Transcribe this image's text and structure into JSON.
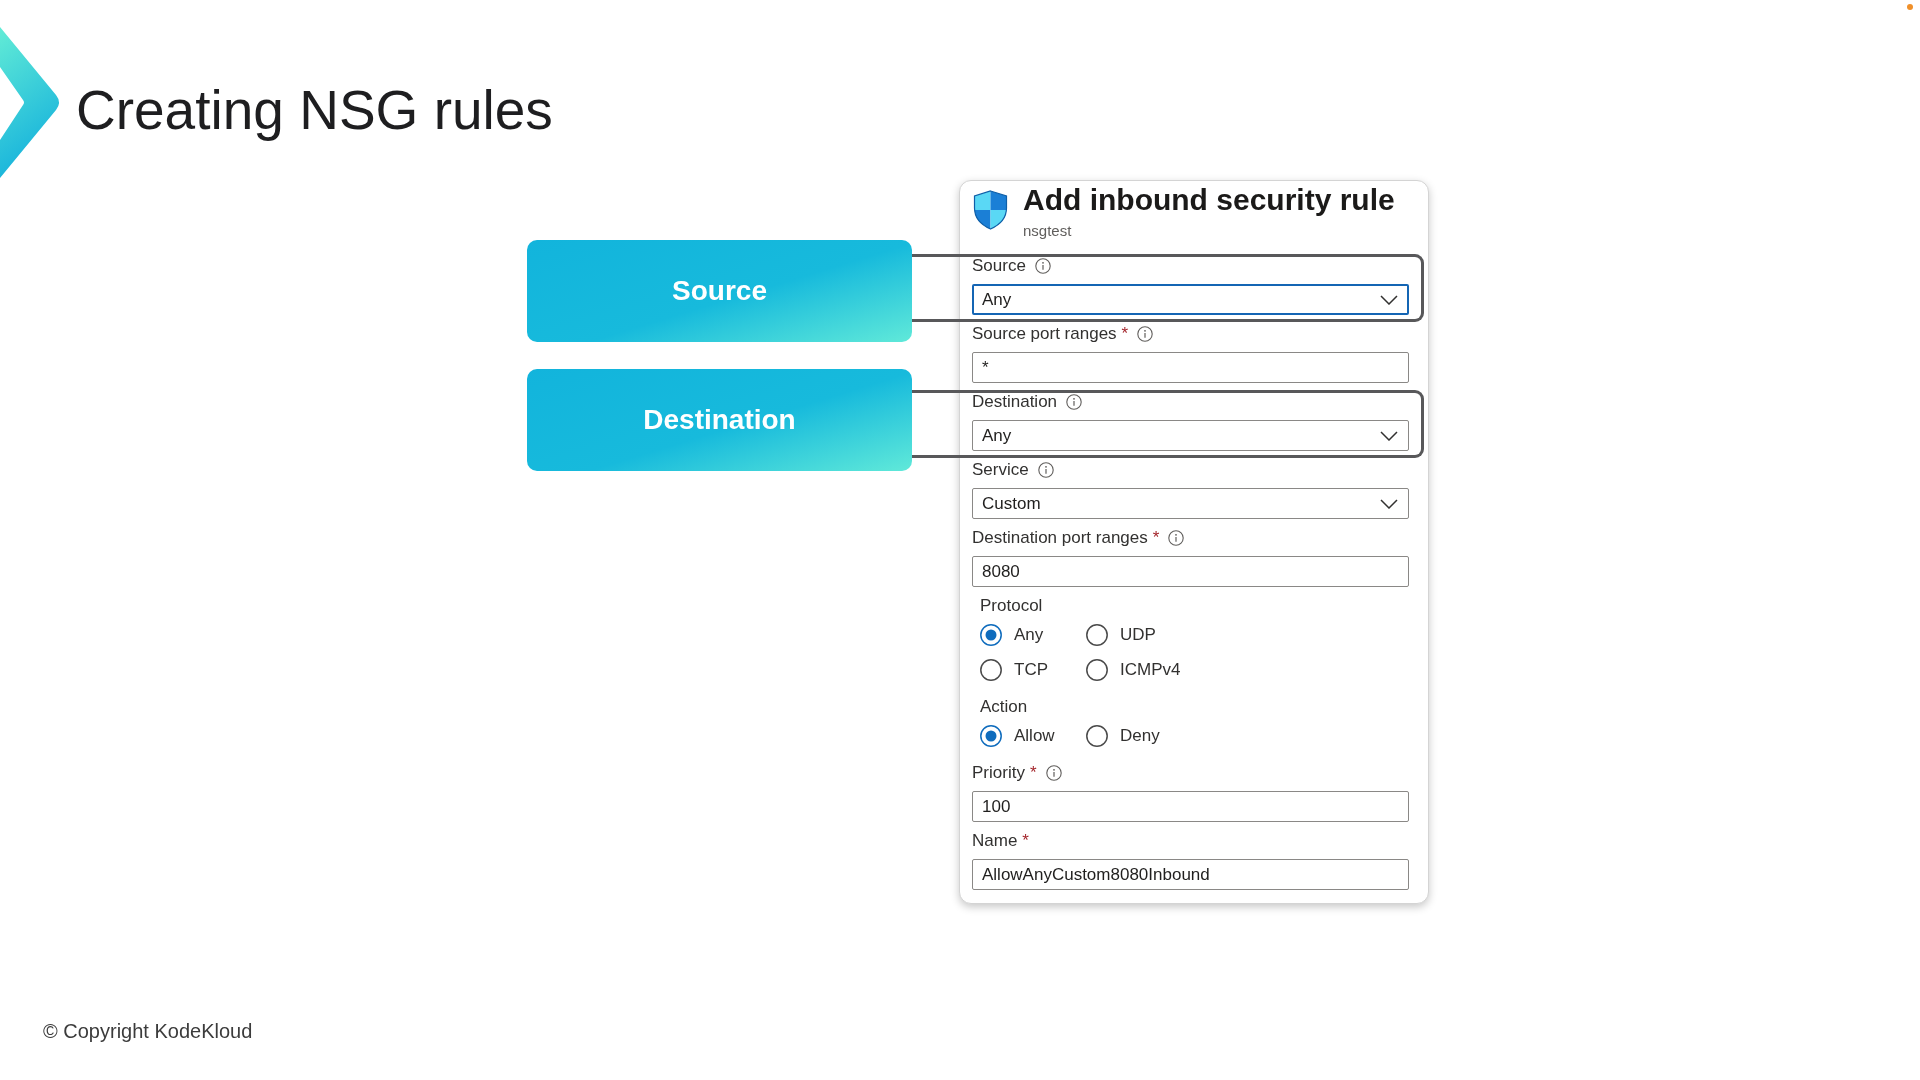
{
  "slide": {
    "title": "Creating NSG rules",
    "copyright": "© Copyright KodeKloud"
  },
  "callouts": [
    {
      "label": "Source"
    },
    {
      "label": "Destination"
    }
  ],
  "panel": {
    "title": "Add inbound security rule",
    "subtitle": "nsgtest",
    "fields": [
      {
        "kind": "dropdown",
        "label": "Source",
        "info": true,
        "value": "Any",
        "focused": true,
        "highlighted": true
      },
      {
        "kind": "text",
        "label": "Source port ranges",
        "required_mark": "*",
        "info": true,
        "value": "*",
        "focused": false,
        "highlighted": false
      },
      {
        "kind": "dropdown",
        "label": "Destination",
        "info": true,
        "value": "Any",
        "focused": false,
        "highlighted": true
      },
      {
        "kind": "dropdown",
        "label": "Service",
        "info": true,
        "value": "Custom",
        "focused": false,
        "highlighted": false
      },
      {
        "kind": "text",
        "label": "Destination port ranges",
        "required_mark": "*",
        "info": true,
        "value": "8080",
        "focused": false,
        "highlighted": false
      },
      {
        "kind": "radio",
        "label": "Protocol",
        "info": false,
        "highlighted": false,
        "options": [
          {
            "label": "Any",
            "selected": true
          },
          {
            "label": "UDP",
            "selected": false
          },
          {
            "label": "TCP",
            "selected": false
          },
          {
            "label": "ICMPv4",
            "selected": false
          }
        ]
      },
      {
        "kind": "radio",
        "label": "Action",
        "info": false,
        "highlighted": false,
        "options": [
          {
            "label": "Allow",
            "selected": true
          },
          {
            "label": "Deny",
            "selected": false
          }
        ]
      },
      {
        "kind": "text",
        "label": "Priority",
        "required_mark": "*",
        "info": true,
        "value": "100",
        "focused": false,
        "highlighted": false
      },
      {
        "kind": "text",
        "label": "Name",
        "required_mark": "*",
        "info": false,
        "value": "AllowAnyCustom8080Inbound",
        "focused": false,
        "highlighted": false
      }
    ]
  }
}
